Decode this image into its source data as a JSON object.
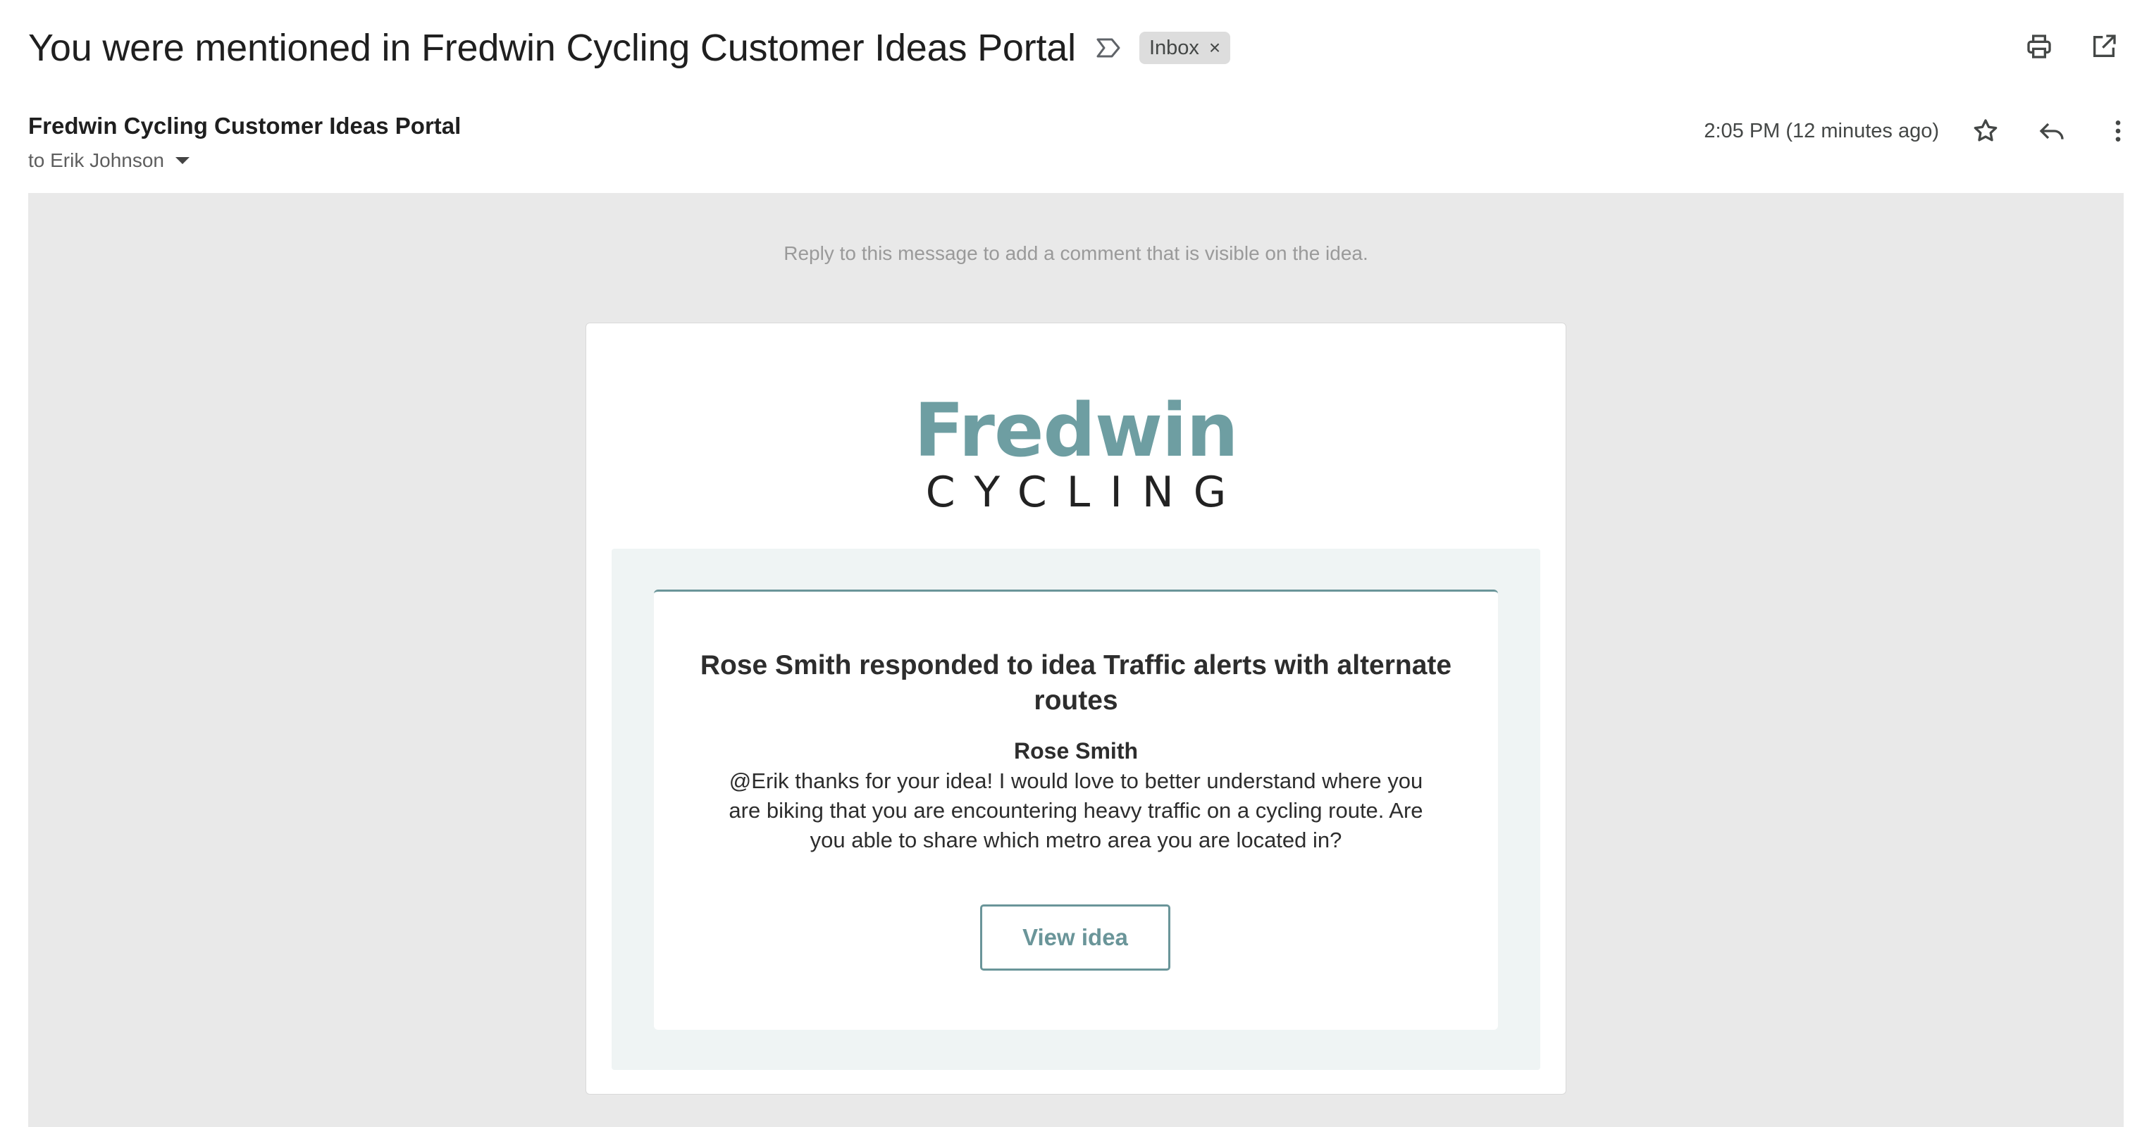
{
  "email": {
    "subject": "You were mentioned in Fredwin Cycling Customer Ideas Portal",
    "label_chip": "Inbox",
    "label_chip_remove": "×",
    "sender": "Fredwin Cycling Customer Ideas Portal",
    "recipient": "to Erik Johnson",
    "timestamp": "2:05 PM (12 minutes ago)"
  },
  "icons": {
    "label": "label-outline-icon",
    "print": "print-icon",
    "open_new_window": "open-in-new-icon",
    "star": "star-outline-icon",
    "reply": "reply-icon",
    "more": "more-vert-icon",
    "recipient_details": "chevron-down-icon"
  },
  "body": {
    "reply_note": "Reply to this message to add a comment that is visible on the idea.",
    "logo": {
      "name": "Fredwin",
      "subtitle": "CYCLING"
    },
    "response_title": "Rose Smith responded to idea Traffic alerts with alternate routes",
    "response_author": "Rose Smith",
    "response_text": "@Erik thanks for your idea! I would love to better understand where you are biking that you are encountering heavy traffic on a cycling route. Are you able to share which metro area you are located in?",
    "view_button": "View idea"
  },
  "colors": {
    "brand_teal": "#6e9ea2",
    "button_teal": "#6a9599",
    "email_background": "#e9e9e9",
    "panel_background": "#eff4f4"
  }
}
